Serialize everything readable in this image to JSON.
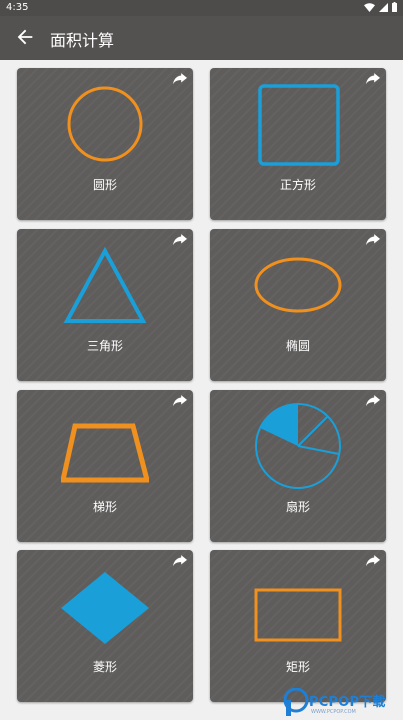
{
  "status_bar": {
    "time": "4:35"
  },
  "app_bar": {
    "title": "面积计算"
  },
  "cards": [
    {
      "label": "圆形",
      "icon": "circle-shape-icon",
      "color": "#f0901e"
    },
    {
      "label": "正方形",
      "icon": "square-shape-icon",
      "color": "#1a9fd9"
    },
    {
      "label": "三角形",
      "icon": "triangle-shape-icon",
      "color": "#1a9fd9"
    },
    {
      "label": "椭圆",
      "icon": "ellipse-shape-icon",
      "color": "#f0901e"
    },
    {
      "label": "梯形",
      "icon": "trapezoid-shape-icon",
      "color": "#f0901e"
    },
    {
      "label": "扇形",
      "icon": "sector-shape-icon",
      "color": "#1a9fd9"
    },
    {
      "label": "菱形",
      "icon": "rhombus-shape-icon",
      "color": "#1a9fd9"
    },
    {
      "label": "矩形",
      "icon": "rectangle-shape-icon",
      "color": "#f0901e"
    }
  ],
  "watermark": {
    "brand": "PCPOP下载",
    "tagline": "WWW.PCPOP.COM"
  }
}
